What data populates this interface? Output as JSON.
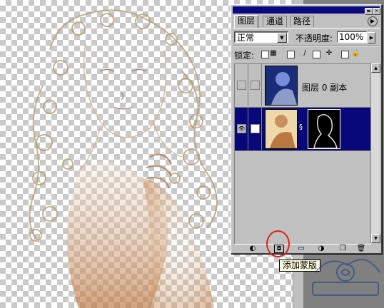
{
  "palette": {
    "tabs": [
      {
        "label": "图层",
        "active": true
      },
      {
        "label": "通道",
        "active": false
      },
      {
        "label": "路径",
        "active": false
      }
    ],
    "blend_mode": "正常",
    "opacity_label": "不透明度:",
    "opacity_value": "100%",
    "lock_label": "锁定:",
    "lock_icons": [
      "lock-transparency-icon",
      "lock-image-icon",
      "brush-icon",
      "move-icon",
      "lock-all-icon"
    ],
    "layers": [
      {
        "name": "图层 0 副本",
        "visible": false,
        "selected": false,
        "has_mask": false
      },
      {
        "name": "",
        "visible": true,
        "selected": true,
        "has_mask": true
      }
    ],
    "bottom_buttons": [
      "layer-style-icon",
      "add-mask-icon",
      "new-set-icon",
      "adjustment-layer-icon",
      "new-layer-icon"
    ],
    "tooltip": "添加蒙版"
  },
  "colors": {
    "selection": "#08087a",
    "highlight_circle": "#e0201a",
    "titlebar": "#0a0a7e"
  }
}
